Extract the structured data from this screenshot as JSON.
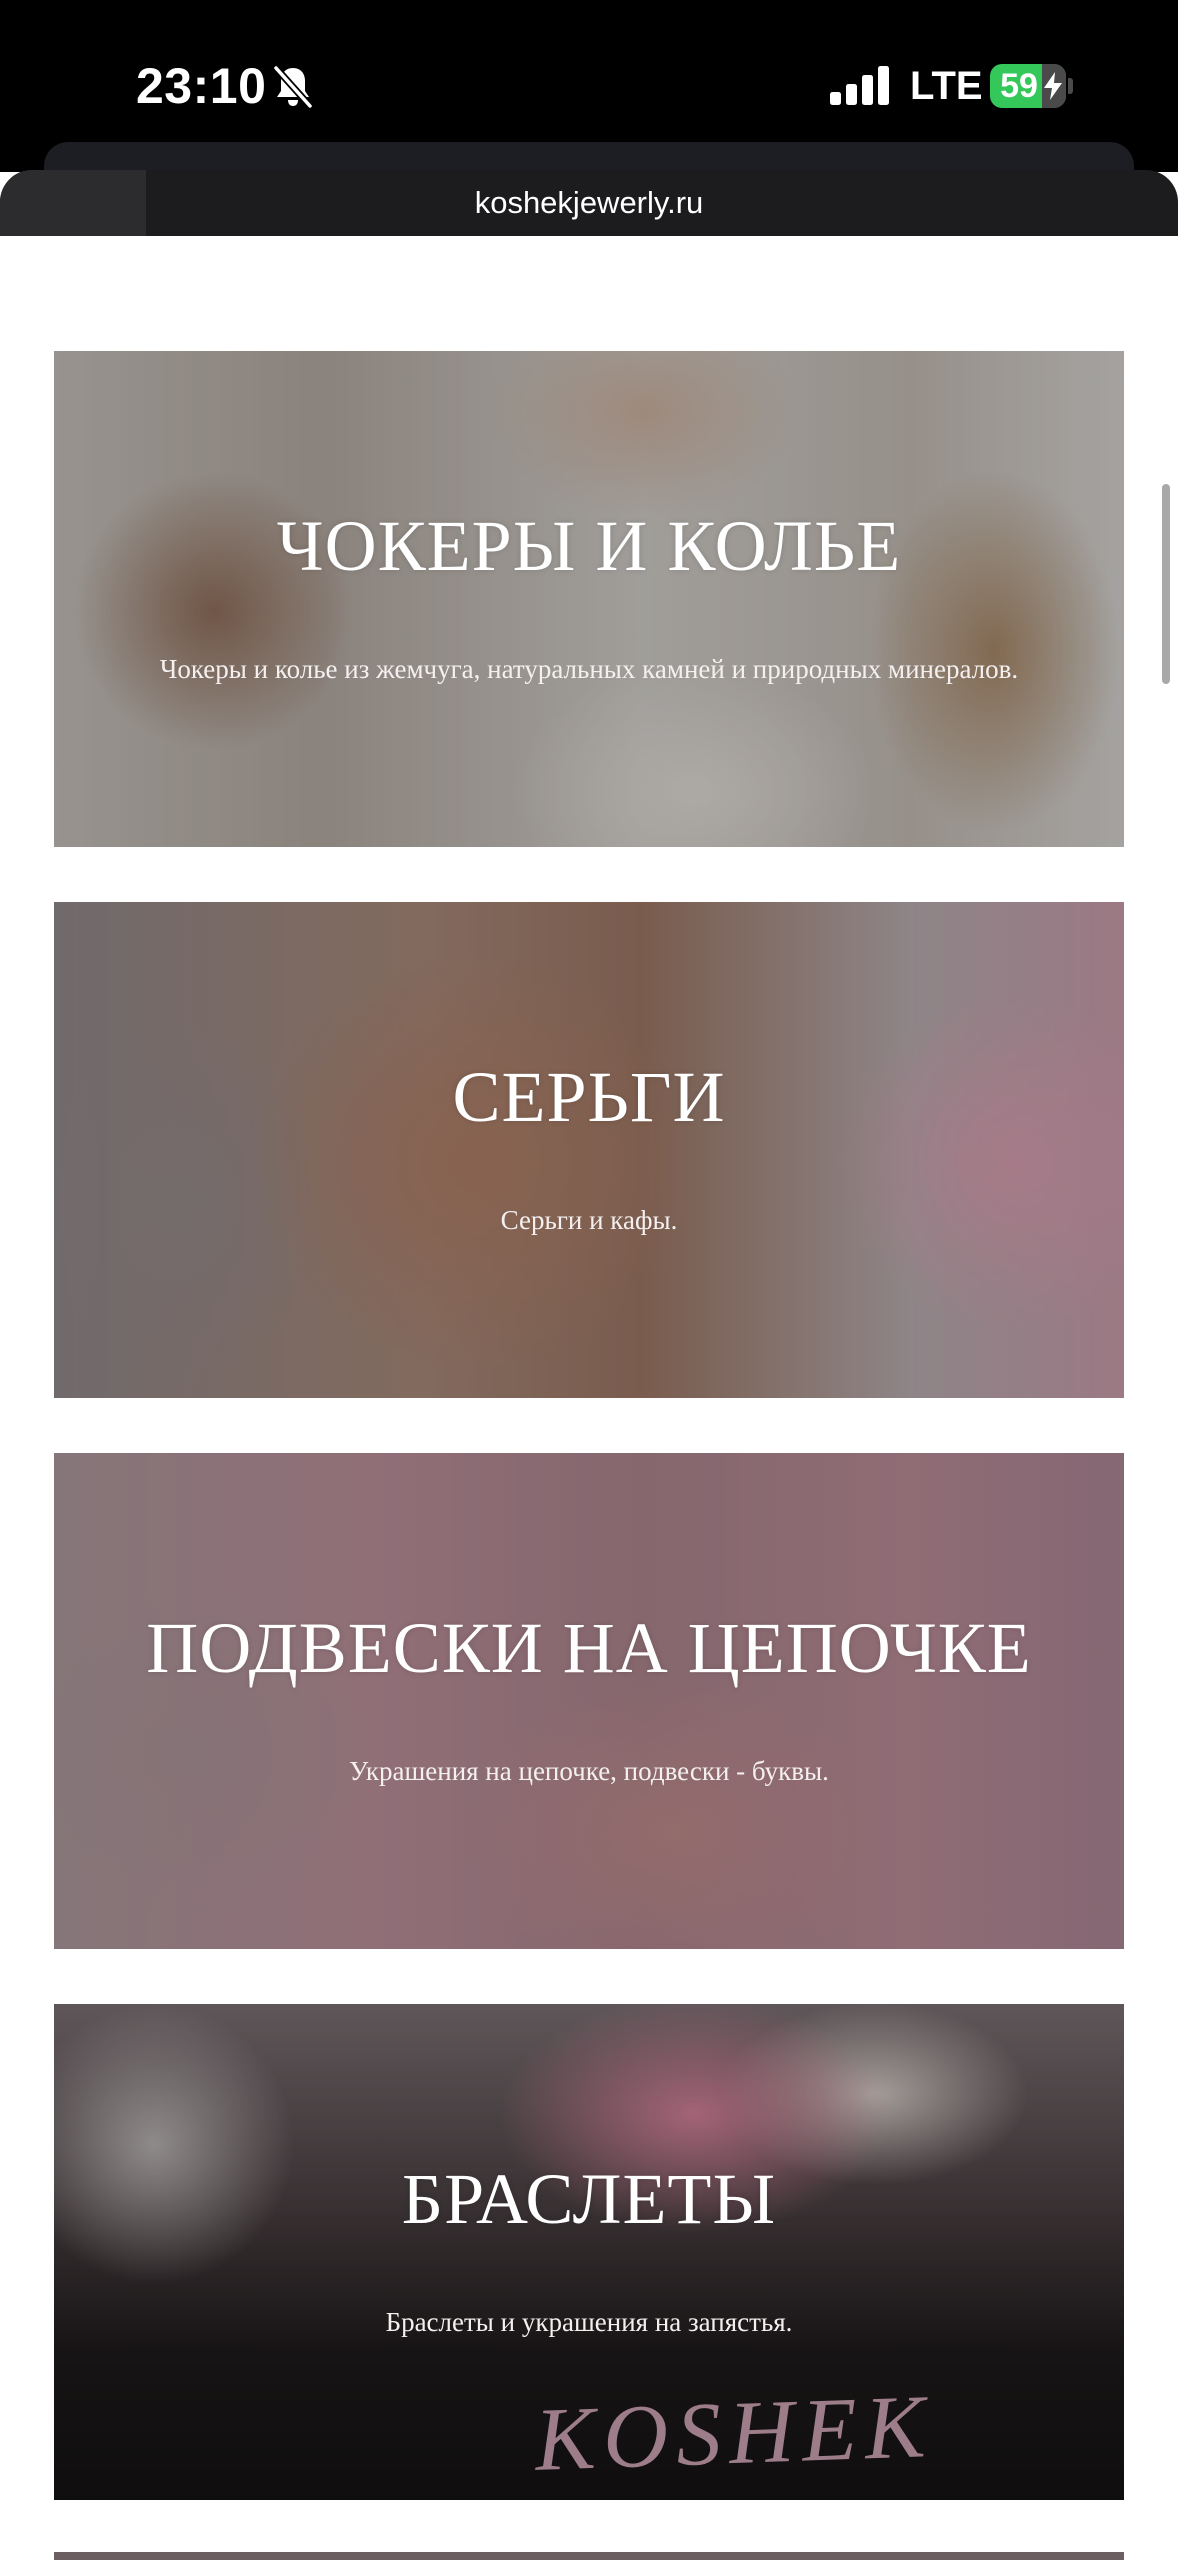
{
  "status_bar": {
    "time": "23:10",
    "network": "LTE",
    "battery": "59",
    "battery_level_percent": 59,
    "icons": [
      "bell-slash-icon",
      "cellular-signal-icon",
      "battery-icon",
      "charging-bolt-icon"
    ],
    "battery_color": "#34c759"
  },
  "browser": {
    "url": "koshekjewerly.ru"
  },
  "categories": [
    {
      "title": "ЧОКЕРЫ И КОЛЬЕ",
      "subtitle": "Чокеры и колье из жемчуга, натуральных камней и природных минералов."
    },
    {
      "title": "СЕРЬГИ",
      "subtitle": "Серьги и кафы."
    },
    {
      "title": "ПОДВЕСКИ НА ЦЕПОЧКЕ",
      "subtitle": "Украшения на цепочке, подвески - буквы."
    },
    {
      "title": "БРАСЛЕТЫ",
      "subtitle": "Браслеты и украшения на запястья.",
      "photo_print": "KOSHEK"
    }
  ]
}
